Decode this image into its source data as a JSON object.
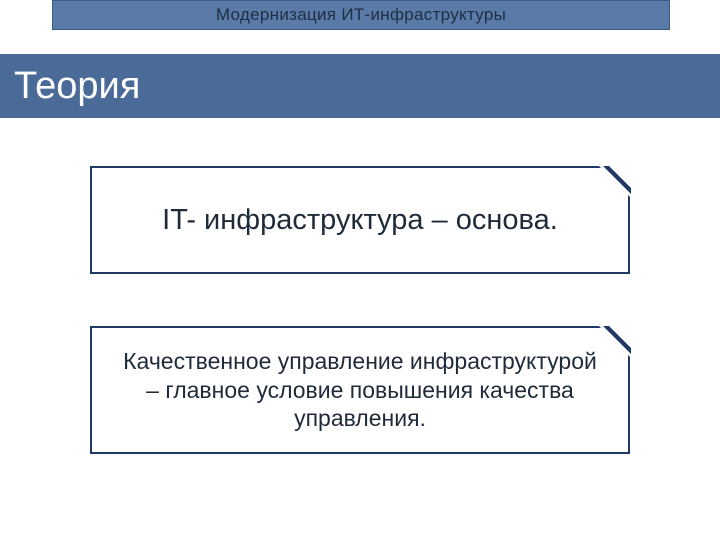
{
  "header": {
    "title": "Модернизация ИТ-инфраструктуры"
  },
  "section": {
    "title": "Теория"
  },
  "callouts": [
    {
      "text": "IT- инфраструктура – основа."
    },
    {
      "text": "Качественное управление инфраструктурой – главное условие повышения качества управления."
    }
  ]
}
